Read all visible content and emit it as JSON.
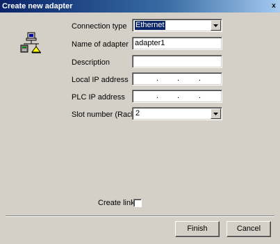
{
  "window": {
    "title": "Create new adapter",
    "close_label": "x"
  },
  "icons": {
    "network": "network-computers-icon",
    "dropdown": "dropdown-arrow-icon",
    "close": "close-icon"
  },
  "form": {
    "connection_type": {
      "label": "Connection type",
      "value": "Ethernet"
    },
    "name": {
      "label": "Name of adapter",
      "value": "adapter1"
    },
    "description": {
      "label": "Description",
      "value": ""
    },
    "local_ip": {
      "label": "Local IP address",
      "separators": [
        ".",
        ".",
        "."
      ]
    },
    "plc_ip": {
      "label": "PLC IP address",
      "separators": [
        ".",
        ".",
        "."
      ]
    },
    "slot": {
      "label": "Slot number (Rack)",
      "value": "2"
    },
    "create_link": {
      "label": "Create link",
      "checked": false
    }
  },
  "buttons": {
    "finish": "Finish",
    "cancel": "Cancel"
  },
  "colors": {
    "face": "#d4d0c8",
    "title_start": "#0a246a",
    "title_end": "#a6caf0",
    "selection": "#0a246a"
  }
}
